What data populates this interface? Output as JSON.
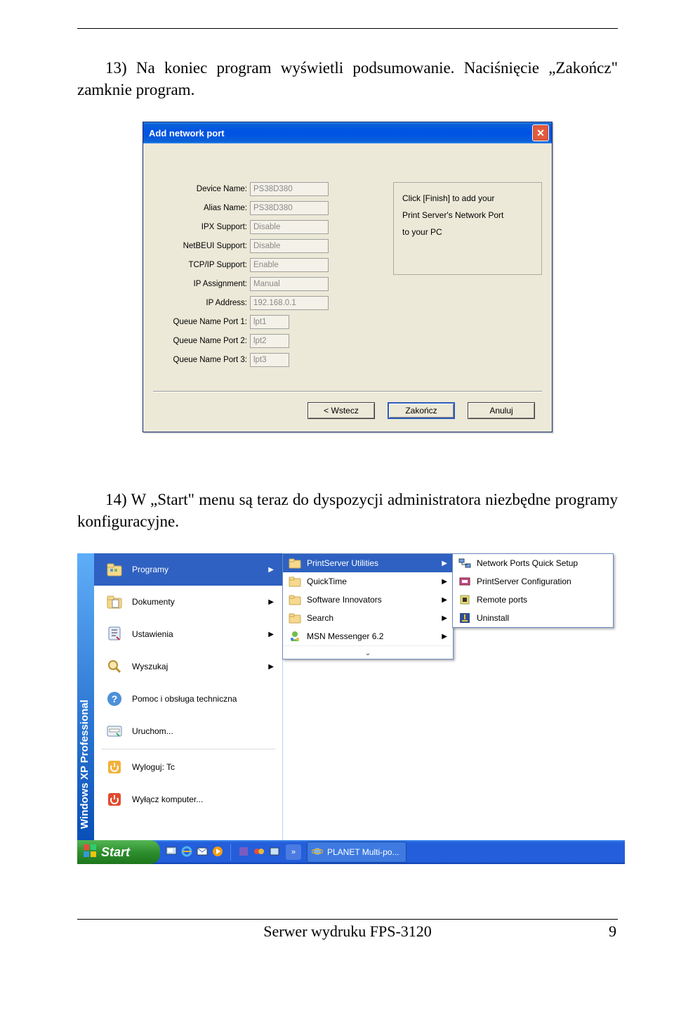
{
  "para13": "13) Na koniec program wyświetli podsumowanie. Naciśnięcie „Zakończ\" zamknie program.",
  "para14": "14) W „Start\" menu są teraz do dyspozycji administratora niezbędne programy konfiguracyjne.",
  "dialog": {
    "title": "Add network port",
    "info": {
      "l1": "Click [Finish] to add your",
      "l2": "Print Server's Network Port",
      "l3": "to your PC"
    },
    "fields": {
      "device_name": {
        "label": "Device Name:",
        "value": "PS38D380"
      },
      "alias_name": {
        "label": "Alias Name:",
        "value": "PS38D380"
      },
      "ipx": {
        "label": "IPX Support:",
        "value": "Disable"
      },
      "netbeui": {
        "label": "NetBEUI Support:",
        "value": "Disable"
      },
      "tcpip": {
        "label": "TCP/IP Support:",
        "value": "Enable"
      },
      "ip_assign": {
        "label": "IP Assignment:",
        "value": "Manual"
      },
      "ip_addr": {
        "label": "IP Address:",
        "value": "192.168.0.1"
      },
      "q1": {
        "label": "Queue Name Port 1:",
        "value": "lpt1"
      },
      "q2": {
        "label": "Queue Name Port 2:",
        "value": "lpt2"
      },
      "q3": {
        "label": "Queue Name Port 3:",
        "value": "lpt3"
      }
    },
    "buttons": {
      "back": "<  Wstecz",
      "finish": "Zakończ",
      "cancel": "Anuluj"
    }
  },
  "start_menu": {
    "vbar": "Windows XP Professional",
    "left": {
      "programy": "Programy",
      "dokumenty": "Dokumenty",
      "ustawienia": "Ustawienia",
      "wyszukaj": "Wyszukaj",
      "pomoc": "Pomoc i obsługa techniczna",
      "uruchom": "Uruchom...",
      "wyloguj": "Wyloguj: Tc",
      "wylacz": "Wyłącz komputer..."
    },
    "sub1": {
      "psu": "PrintServer Utilities",
      "qt": "QuickTime",
      "si": "Software Innovators",
      "search": "Search",
      "msn": "MSN Messenger 6.2"
    },
    "sub2": {
      "npqs": "Network Ports Quick Setup",
      "psc": "PrintServer Configuration",
      "rp": "Remote ports",
      "un": "Uninstall"
    },
    "taskbar": {
      "start": "Start",
      "task": "PLANET Multi-po..."
    }
  },
  "footer": {
    "center": "Serwer wydruku FPS-3120",
    "page": "9"
  }
}
